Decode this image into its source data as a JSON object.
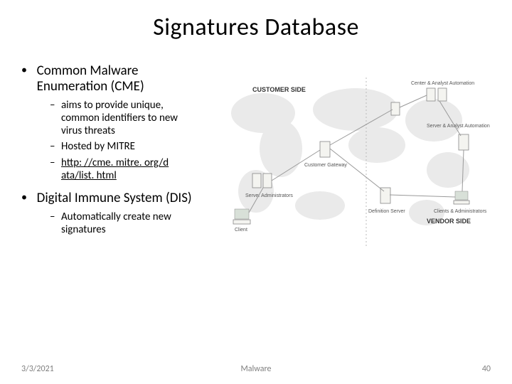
{
  "title": "Signatures Database",
  "bullets": [
    {
      "text": "Common Malware Enumeration (CME)",
      "sub": [
        {
          "text": "aims to provide unique, common identifiers to new virus threats"
        },
        {
          "text": "Hosted by MITRE"
        },
        {
          "text": "http: //cme. mitre. org/d ata/list. html",
          "link": true
        }
      ]
    },
    {
      "text": "Digital Immune System (DIS)",
      "sub": [
        {
          "text": "Automatically create new signatures"
        }
      ]
    }
  ],
  "diagram": {
    "left_heading": "CUSTOMER SIDE",
    "right_heading": "VENDOR SIDE",
    "nodes": {
      "client": "Client",
      "server_admin": "Server Administrators",
      "gateway": "Customer Gateway",
      "def_server": "Definition Server",
      "center_top": "Center & Analyst Automation",
      "server_right": "Server & Analyst Automation",
      "clients_admin": "Clients & Administrators"
    }
  },
  "footer": {
    "date": "3/3/2021",
    "topic": "Malware",
    "page": "40"
  }
}
